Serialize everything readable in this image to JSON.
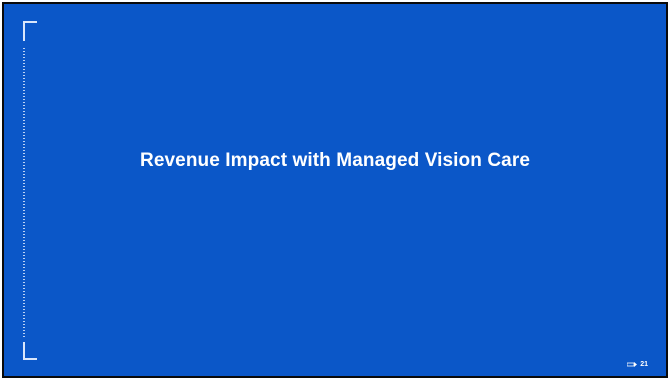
{
  "slide": {
    "title": "Revenue Impact with Managed Vision Care",
    "page_number": "21",
    "colors": {
      "background": "#0b57c8",
      "text": "#ffffff",
      "accent_lines": "#d9e6fb"
    },
    "icons": {
      "page_indicator": "arrow-icon"
    }
  }
}
